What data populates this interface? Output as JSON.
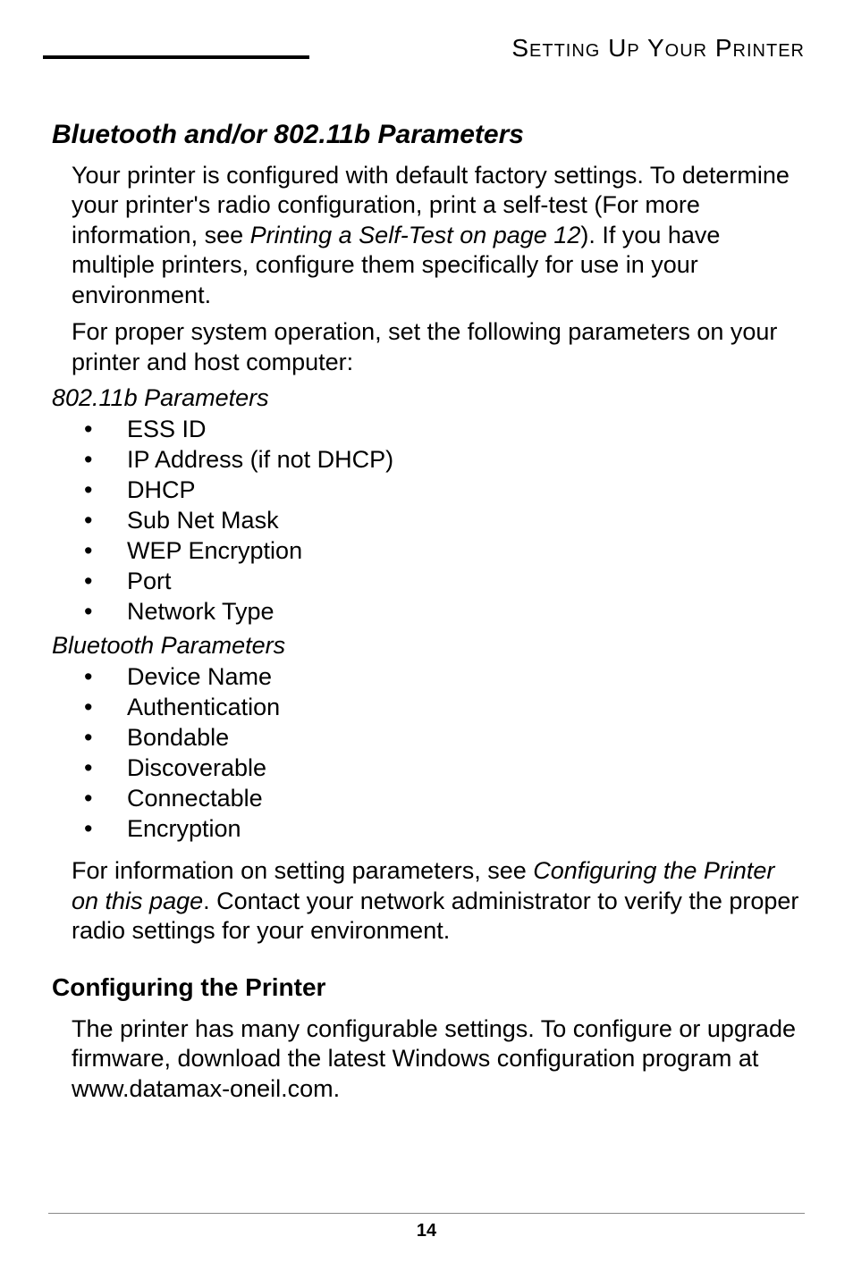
{
  "header": {
    "running_title": "Setting Up Your Printer"
  },
  "section1": {
    "title": "Bluetooth and/or 802.11b Parameters",
    "para1_a": "Your printer is configured with default factory settings. To determine your printer's radio configuration, print a self-test (For more information, see ",
    "para1_ital": "Printing a Self-Test on page 12",
    "para1_b": "). If you have multiple printers, configure them specifically for use in your environment.",
    "para2": "For proper system operation, set the following parameters on your printer and host computer:",
    "subhead_a": "802.11b Parameters",
    "list_a": [
      "ESS ID",
      "IP Address (if not DHCP)",
      "DHCP",
      "Sub Net Mask",
      "WEP Encryption",
      "Port",
      "Network Type"
    ],
    "subhead_b": "Bluetooth Parameters",
    "list_b": [
      "Device Name",
      "Authentication",
      "Bondable",
      "Discoverable",
      "Connectable",
      "Encryption"
    ],
    "para3_a": "For information on setting parameters, see ",
    "para3_ital": "Configuring the Printer on this page",
    "para3_b": ". Contact your network administrator to verify the proper radio settings for your environment."
  },
  "section2": {
    "title": "Configuring the Printer",
    "para1": "The printer has many configurable settings. To configure or upgrade firmware, download the latest Windows configuration program at www.datamax-oneil.com."
  },
  "footer": {
    "page": "14"
  }
}
